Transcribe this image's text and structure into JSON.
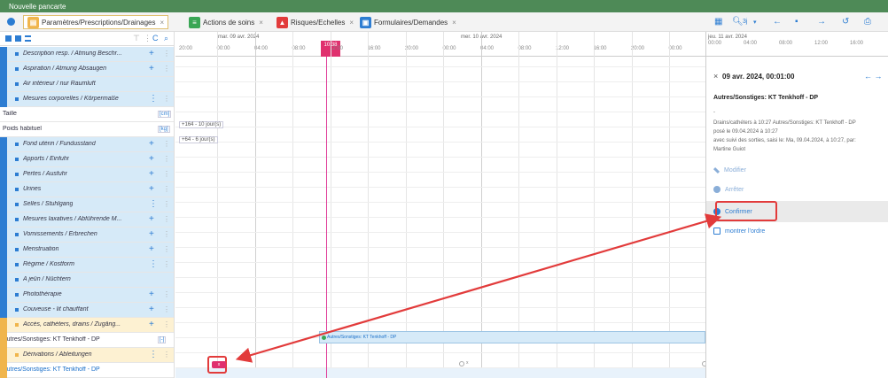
{
  "window": {
    "title": "Nouvelle pancarte"
  },
  "tabs": [
    {
      "label": "Paramètres/Prescriptions/Drainages",
      "icon": "doc-icon",
      "color": "#f0b54c",
      "active": true
    },
    {
      "label": "Actions de soins",
      "icon": "list-icon",
      "color": "#3aa655"
    },
    {
      "label": "Risques/Echelles",
      "icon": "warning-icon",
      "color": "#e23b3b"
    },
    {
      "label": "Formulaires/Demandes",
      "icon": "form-icon",
      "color": "#2d7dd2"
    }
  ],
  "toolbar": {
    "zoom_label": "3j",
    "close_glyph": "×"
  },
  "left_rows": [
    {
      "label": "Description resp. / Atmung Beschr...",
      "style": "blue",
      "ctl": "+"
    },
    {
      "label": "Aspiration / Atmung Absaugen",
      "style": "blue",
      "ctl": "+"
    },
    {
      "label": "Air intérieur / nur Raumluft",
      "style": "blue",
      "ctl": ""
    },
    {
      "label": "Mesures corporelles / Körpermaße",
      "style": "blue",
      "ctl": "⋮"
    },
    {
      "label": "Taille",
      "style": "plain",
      "unit": "[cm]"
    },
    {
      "label": "Poids habituel",
      "style": "plain",
      "unit": "[kg]"
    },
    {
      "label": "Fond utérin / Fundusstand",
      "style": "blue",
      "ctl": "+"
    },
    {
      "label": "Apports / Einfuhr",
      "style": "blue",
      "ctl": "+"
    },
    {
      "label": "Pertes / Ausfuhr",
      "style": "blue",
      "ctl": "+"
    },
    {
      "label": "Urines",
      "style": "blue",
      "ctl": "+"
    },
    {
      "label": "Selles / Stuhlgang",
      "style": "blue",
      "ctl": "⋮"
    },
    {
      "label": "Mesures laxatives / Abführende M...",
      "style": "blue",
      "ctl": "+"
    },
    {
      "label": "Vomissements / Erbrechen",
      "style": "blue",
      "ctl": "+"
    },
    {
      "label": "Menstruation",
      "style": "blue",
      "ctl": "+"
    },
    {
      "label": "Régime / Kostform",
      "style": "blue",
      "ctl": "⋮"
    },
    {
      "label": "A jeûn / Nüchtern",
      "style": "blue",
      "ctl": ""
    },
    {
      "label": "Photothérapie",
      "style": "blue",
      "ctl": "+"
    },
    {
      "label": "Couveuse - lit chauffant",
      "style": "blue",
      "ctl": "+"
    },
    {
      "label": "Accès, cathéters, drains / Zugäng...",
      "style": "orange",
      "ctl": "+"
    },
    {
      "label": "Autres/Sonstiges: KT Tenkhoff - DP",
      "style": "plain",
      "unit": "[-]"
    },
    {
      "label": "Dérivations / Ableitungen",
      "style": "orange",
      "ctl": "⋮"
    },
    {
      "label": "Autres/Sonstiges: KT Tenkhoff - DP",
      "style": "plain-blue",
      "ctl": ""
    }
  ],
  "grid": {
    "days": [
      {
        "label": "mar. 09 avr. 2024"
      },
      {
        "label": "mer. 10 avr. 2024"
      },
      {
        "label": "jeu. 11 avr. 2024"
      }
    ],
    "hours": [
      "20:00",
      "00:00",
      "04:00",
      "08:00",
      "12:00",
      "16:00",
      "20:00",
      "00:00",
      "04:00",
      "08:00",
      "12:00",
      "16:00",
      "20:00",
      "00:00"
    ],
    "now_label": "10:38",
    "taille_value": "+164 - 10 jour(s)",
    "poids_value": "+64 - 6 jour(s)",
    "event_label": "Autres/Sonstiges: KT Tenkhoff - DP",
    "marker_label": "x",
    "tag_label": "x"
  },
  "detail": {
    "header_title": "09 avr. 2024, 00:01:00",
    "subtitle": "Autres/Sonstiges: KT Tenkhoff - DP",
    "dash": "-",
    "lines": [
      "Drains/cathéters à 10:27 Autres/Sonstiges: KT Tenkhoff - DP",
      "posé le 09.04.2024 à 10:27",
      "avec suivi des sorties, saisi le: Ma, 09.04.2024, à 10:27, par:",
      "Martine Guiot"
    ],
    "actions": [
      {
        "label": "Modifier",
        "icon": "pencil-icon",
        "enabled": false
      },
      {
        "label": "Arrêter",
        "icon": "stop-icon",
        "enabled": false
      },
      {
        "label": "Confirmer",
        "icon": "check-icon",
        "enabled": true,
        "highlighted": true
      },
      {
        "label": "montrer l'ordre",
        "icon": "document-icon",
        "enabled": true
      }
    ],
    "header_day": "jeu. 11 avr. 2024",
    "header_hours": [
      "00:00",
      "04:00",
      "08:00",
      "12:00",
      "16:00"
    ]
  },
  "annotation_color": "#e23b3b"
}
